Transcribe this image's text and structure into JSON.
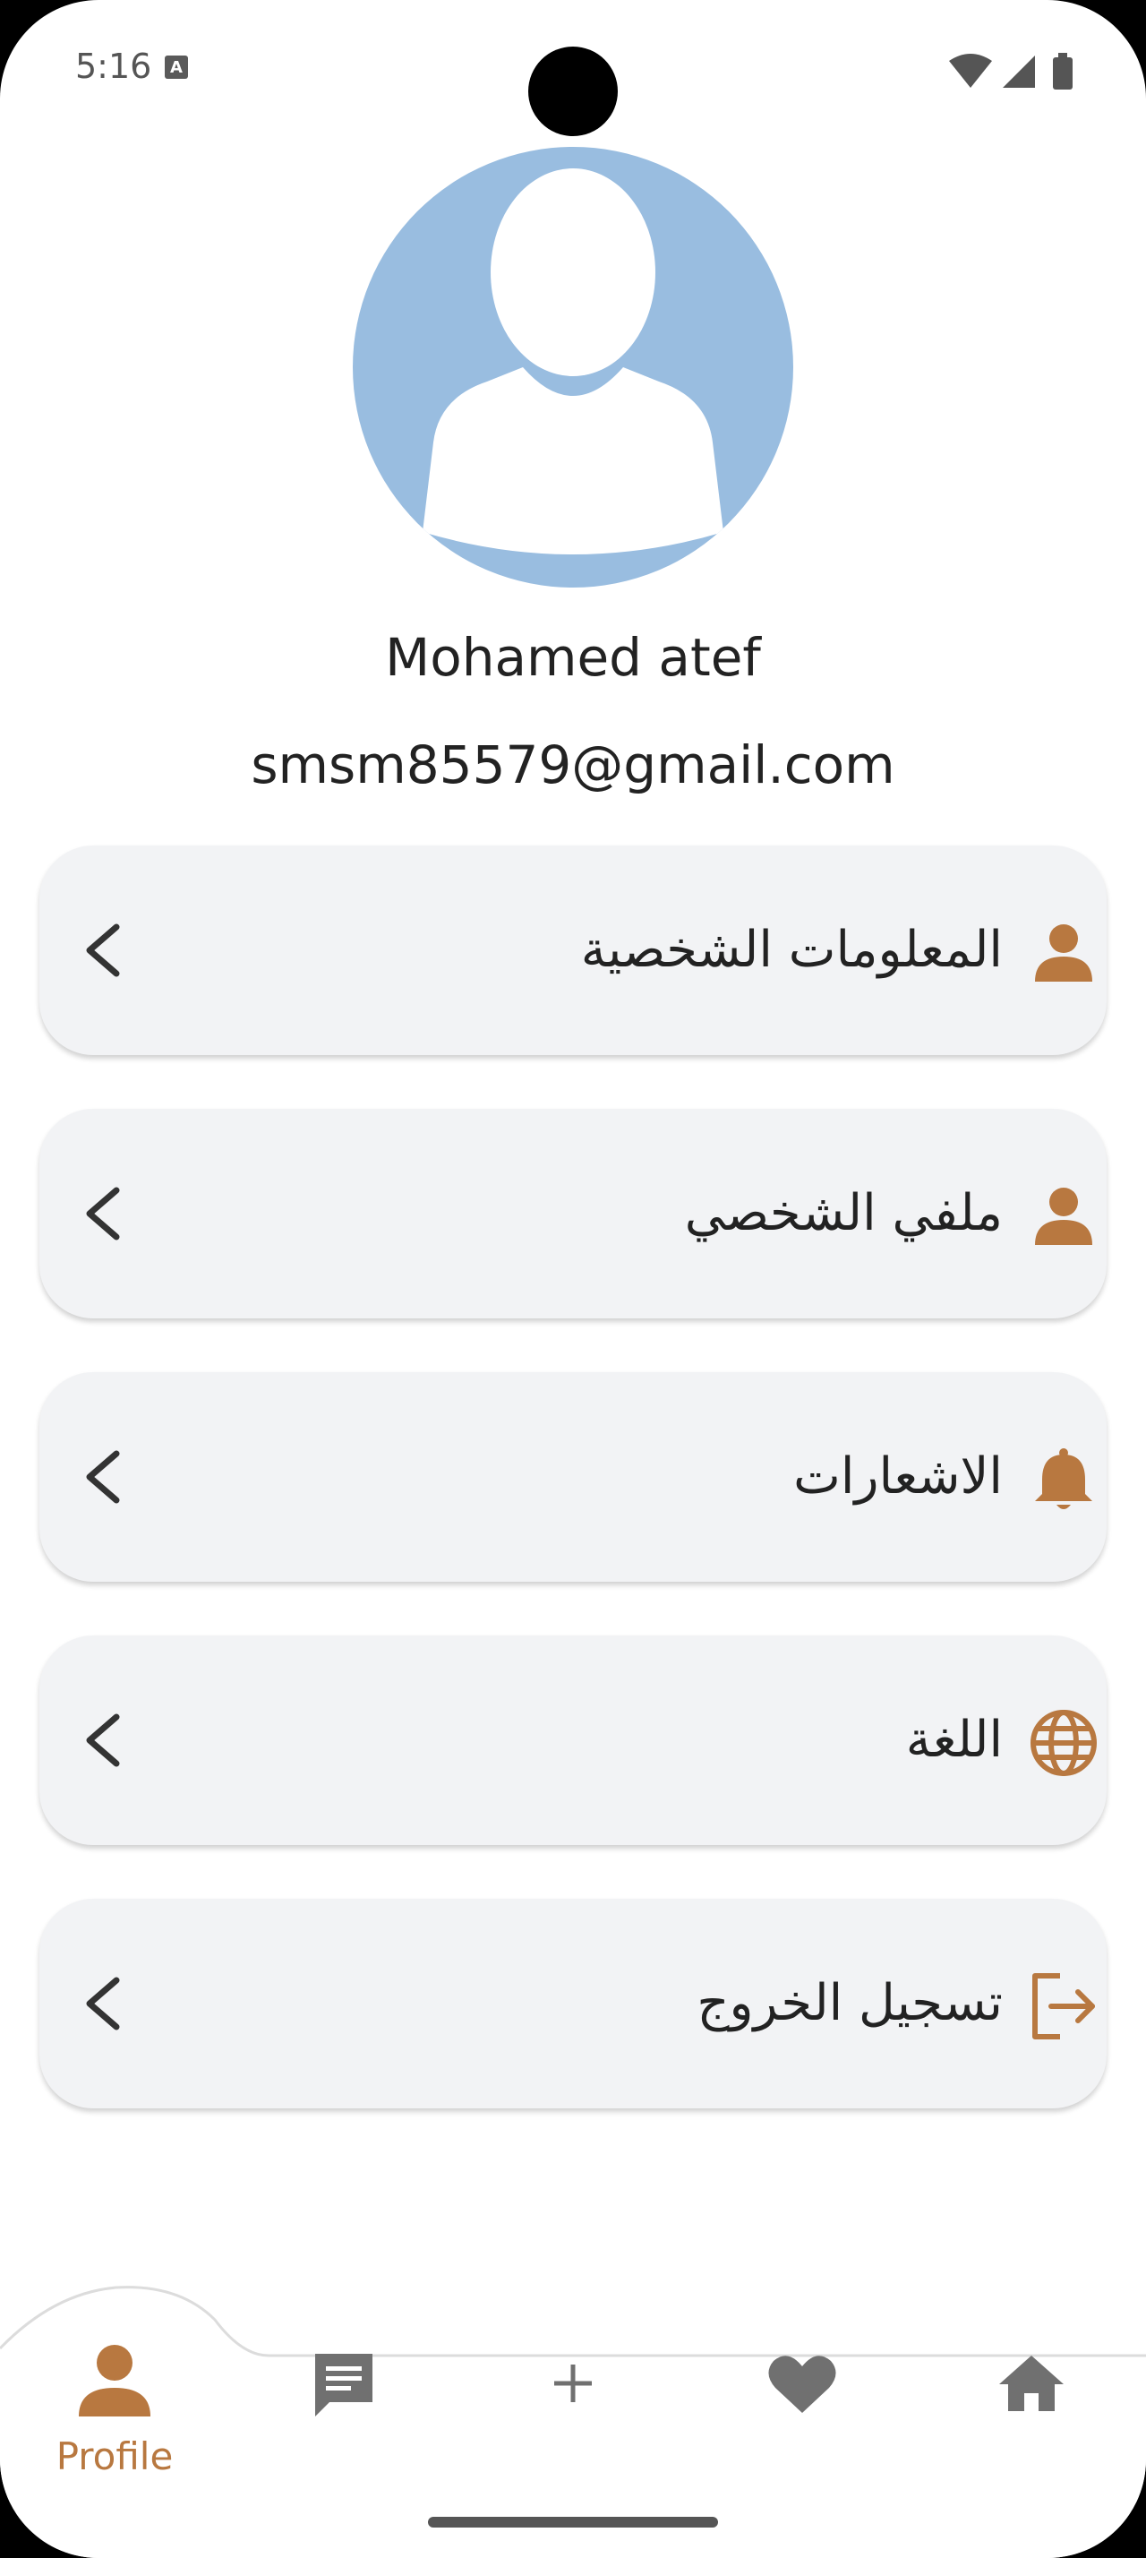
{
  "status_bar": {
    "time": "5:16",
    "notification_glyph": "A",
    "icons": [
      "wifi-icon",
      "cell-signal-icon",
      "battery-icon"
    ]
  },
  "profile": {
    "name": "Mohamed atef",
    "email": "smsm85579@gmail.com"
  },
  "menu": [
    {
      "label": "المعلومات الشخصية",
      "icon": "person-icon"
    },
    {
      "label": "ملفي الشخصي",
      "icon": "person-icon"
    },
    {
      "label": "الاشعارات",
      "icon": "bell-icon"
    },
    {
      "label": "اللغة",
      "icon": "globe-icon"
    },
    {
      "label": "تسجيل الخروج",
      "icon": "logout-icon"
    }
  ],
  "bottom_nav": {
    "active": "profile",
    "items": [
      {
        "label": "Profile",
        "icon": "person-icon"
      },
      {
        "label": "",
        "icon": "chat-icon"
      },
      {
        "label": "",
        "icon": "plus-icon"
      },
      {
        "label": "",
        "icon": "heart-icon"
      },
      {
        "label": "",
        "icon": "home-icon"
      }
    ]
  },
  "colors": {
    "accent": "#b87840",
    "avatar_bg": "#99bde0",
    "card_bg": "#f2f3f5",
    "nav_inactive": "#707070"
  }
}
